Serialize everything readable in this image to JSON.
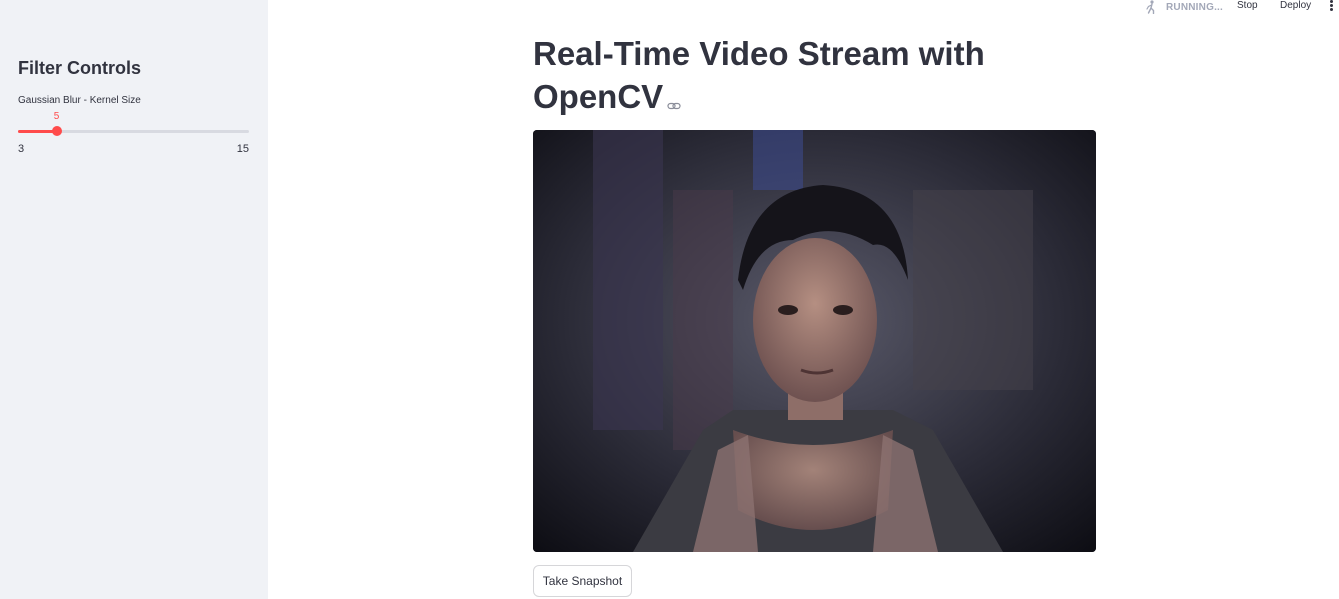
{
  "sidebar": {
    "title": "Filter Controls",
    "slider": {
      "label": "Gaussian Blur - Kernel Size",
      "value": 5,
      "min": 3,
      "max": 15,
      "value_text": "5",
      "min_text": "3",
      "max_text": "15"
    }
  },
  "topbar": {
    "status": "RUNNING...",
    "status_icon": "running-person-icon",
    "stop_label": "Stop",
    "deploy_label": "Deploy",
    "menu_icon": "vertical-dots-icon"
  },
  "main": {
    "title": "Real-Time Video Stream with OpenCV",
    "anchor_icon": "link-icon",
    "video_feed": "webcam-frame",
    "snapshot_label": "Take Snapshot"
  },
  "colors": {
    "accent": "#ff4b4b",
    "sidebar_bg": "#f0f2f6",
    "text": "#31333f",
    "muted": "#a3a8b8"
  }
}
